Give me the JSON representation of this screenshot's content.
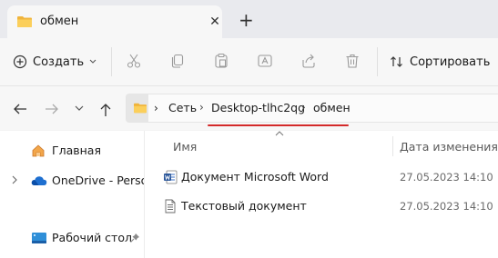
{
  "window": {
    "tab_title": "обмен",
    "tab_close": "✕",
    "new_tab": "+"
  },
  "toolbar": {
    "create_label": "Создать",
    "sort_label": "Сортировать",
    "icons": [
      "cut-icon",
      "copy-icon",
      "paste-icon",
      "rename-icon",
      "share-icon",
      "delete-icon"
    ]
  },
  "address": {
    "chevron": "›",
    "crumbs": [
      "Сеть",
      "Desktop-tlhc2qg",
      "обмен"
    ]
  },
  "annotation": {
    "underline_color": "#d42a2a"
  },
  "sidebar": {
    "items": [
      {
        "label": "Главная"
      },
      {
        "label": "OneDrive - Personal"
      },
      {
        "label": "Рабочий стол"
      }
    ]
  },
  "file_list": {
    "columns": [
      "Имя",
      "Дата изменения"
    ],
    "rows": [
      {
        "name": "Документ Microsoft Word",
        "date": "27.05.2023 14:10",
        "icon": "word-document-icon"
      },
      {
        "name": "Текстовый документ",
        "date": "27.05.2023 14:10",
        "icon": "text-document-icon"
      }
    ]
  }
}
